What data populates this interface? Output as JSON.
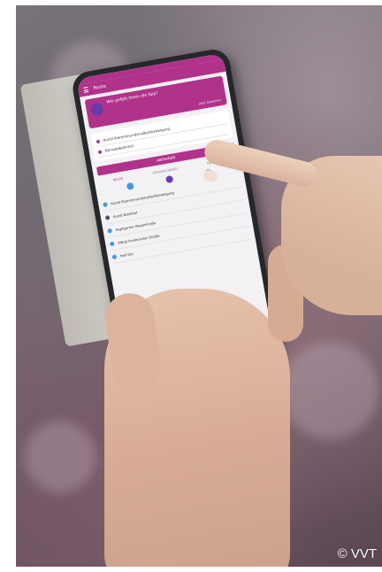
{
  "photo": {
    "subject": "",
    "copyright": "© VVT"
  },
  "app": {
    "title": "Route",
    "accent_color": "#b0328a",
    "promo_text": "Wie gefällt Ihnen die App?",
    "promo_link": "jetzt bewerten",
    "search_button": "ABFAHREN",
    "route_from": "Kundl Klammmundstraße/Abzweigung",
    "route_to": "Bhnsiedbahnhof",
    "tabs": [
      "HEUTE",
      "VERBINDUNGEN",
      "FAHRPLAN"
    ],
    "stops": [
      "Kundl Klammmundstraße/Abzweigung",
      "Kundl Bahnhof",
      "Hopfgarten Rosenstraße",
      "Wörgl Innsbrucker Straße",
      "Hall Ost"
    ]
  }
}
